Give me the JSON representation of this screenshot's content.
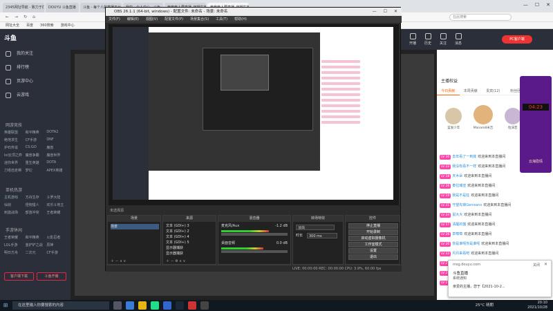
{
  "browser": {
    "tabs": [
      "2345网址导航 - 致力于打造百",
      "DOUYU 斗鱼直播",
      "斗鱼 - 每个人的直播平台",
      "我的 - 个人中心 - 斗鱼",
      "奔奔奔人要直播_守望先锋",
      "奔奔奔人要直播_守望先锋直播"
    ],
    "active_tab": 5,
    "search_placeholder": "在此搜索",
    "bookmarks": [
      "网址大全",
      "百度",
      "360搜索",
      "游戏中心"
    ],
    "nav_icons": [
      "back-icon",
      "forward-icon",
      "refresh-icon",
      "home-icon"
    ]
  },
  "site": {
    "logo": "斗鱼",
    "nav": [
      "我的关注",
      "排行榜",
      "页游中心",
      "云游戏"
    ],
    "sec_hot": "网游竞技",
    "cat_hot": [
      "英雄联盟",
      "和平精英",
      "DOTA2",
      "绝地求生",
      "CF手游",
      "DNF",
      "炉石传说",
      "CS:GO",
      "魔兽",
      "lol云顶之弈",
      "魔兽争霸",
      "魔兽世界",
      "迷你世界",
      "重生英雄",
      "DOTA",
      "刀塔自走棋",
      "梦幻",
      "APEX英雄"
    ],
    "sec_mobile": "单机热游",
    "cat_mobile": [
      "主机游戏",
      "方舟生存",
      "斗罗大陆",
      "仙剑",
      "怪物猎人",
      "欢乐斗地主",
      "刺激战场",
      "部落冲突",
      "王者荣耀"
    ],
    "sec_more": "手游休闲",
    "cat_more": [
      "王者荣耀",
      "和平精英",
      "火影忍者",
      "LOL手游",
      "金铲铲之战",
      "原神",
      "明日方舟",
      "二次元",
      "CF手游"
    ],
    "side_buttons": [
      "客户端下载",
      "斗鱼开播"
    ],
    "header_tools": [
      {
        "label": "开播",
        "icon": "camera-icon"
      },
      {
        "label": "历史",
        "icon": "history-icon"
      },
      {
        "label": "关注",
        "icon": "heart-icon"
      },
      {
        "label": "消息",
        "icon": "bell-icon"
      }
    ],
    "header_right": [
      "鱼吧VIP",
      "小飞鱼礼物",
      "创作中心"
    ],
    "pc_button": "PC客户端"
  },
  "right_panel": {
    "title": "主播权益",
    "tabs": [
      "今日贡献",
      "本周贡献",
      "贵宾(12)",
      "粉丝团"
    ],
    "contributors": [
      "蓝发少年",
      "Manam8米吉",
      "粒沫若"
    ],
    "chat": [
      {
        "badge": "LV 30",
        "user": "去年看了一到底",
        "text": "欢迎来到本直播间"
      },
      {
        "badge": "LV 22",
        "user": "我没有看不一样",
        "text": "欢迎来到本直播间"
      },
      {
        "badge": "LV 18",
        "user": "天木朵",
        "text": "欢迎来到本直播间"
      },
      {
        "badge": "LV 26",
        "user": "泰拉瑞亚",
        "text": "欢迎来到本直播间"
      },
      {
        "badge": "LV 19",
        "user": "我是不是狂",
        "text": "欢迎来到本直播间"
      },
      {
        "badge": "LV 31",
        "user": "守望先锋Genisans",
        "text": "欢迎来到本直播间"
      },
      {
        "badge": "LV 24",
        "user": "鼠大大",
        "text": "欢迎来到本直播间"
      },
      {
        "badge": "LV 17",
        "user": "清醒的猫",
        "text": "欢迎来到本直播间"
      },
      {
        "badge": "LV 28",
        "user": "草莓莓",
        "text": "欢迎来到本直播间"
      },
      {
        "badge": "LV 20",
        "user": "你是谁呢你是谁呢",
        "text": "欢迎来到本直播间"
      },
      {
        "badge": "LV 33",
        "user": "月月来看吧",
        "text": "欢迎来到本直播间"
      },
      {
        "badge": "LV 21",
        "user": "嘿嘿安安安",
        "text": "欢迎来到本直播间"
      },
      {
        "badge": "LV 25",
        "user": "大大Nosal",
        "text": "欢迎来到本直播间"
      },
      {
        "badge": "LV 27",
        "user": "月亮来了",
        "text": "欢迎来到本直播间"
      }
    ],
    "promo_timer": "04:23",
    "promo_text": "云海隐情"
  },
  "obs": {
    "title": "OBS 26.1.1 (64-bit, windows) - 配置文件: 未命名 - 场景: 未命名",
    "menu": [
      "文件(F)",
      "编辑(E)",
      "视图(V)",
      "配置文件(P)",
      "场景集合(S)",
      "工具(T)",
      "帮助(H)"
    ],
    "status_label": "未选择源",
    "docks": {
      "scenes": {
        "title": "场景",
        "items": [
          "场景"
        ]
      },
      "sources": {
        "title": "来源",
        "items": [
          "文本 (GDI+) 3",
          "文本 (GDI+) 2",
          "文本 (GDI+) 4",
          "文本 (GDI+) 5",
          "显示器捕获",
          "显示器捕获"
        ]
      },
      "mixer": {
        "title": "混音器",
        "channels": [
          {
            "name": "麦克风/Aux",
            "db": "-1.2 dB",
            "level": 0.72
          },
          {
            "name": "桌面音频",
            "db": "0.0 dB",
            "level": 0.64
          }
        ]
      },
      "transitions": {
        "title": "转场特效",
        "type": "淡出",
        "duration_label": "时长",
        "duration": "300 ms"
      },
      "controls": {
        "title": "控件",
        "buttons": [
          "停止直播",
          "开始录制",
          "启动虚拟摄像机",
          "工作室模式",
          "设置",
          "退出"
        ]
      }
    },
    "statusbar": "LIVE: 00:00:00   REC: 00:00:00   CPU: 3.9%, 60.00 fps"
  },
  "notification": {
    "domain": "msg.douyu.com",
    "action": "关闭",
    "title": "斗鱼直播",
    "subtitle": "系统通知",
    "body": "亲爱的主播，您于【2021-10-2..."
  },
  "taskbar": {
    "search_placeholder": "在这里输入你要搜索的内容",
    "weather": "25°C 晴朗",
    "time": "20:10",
    "date": "2021/10/28"
  }
}
